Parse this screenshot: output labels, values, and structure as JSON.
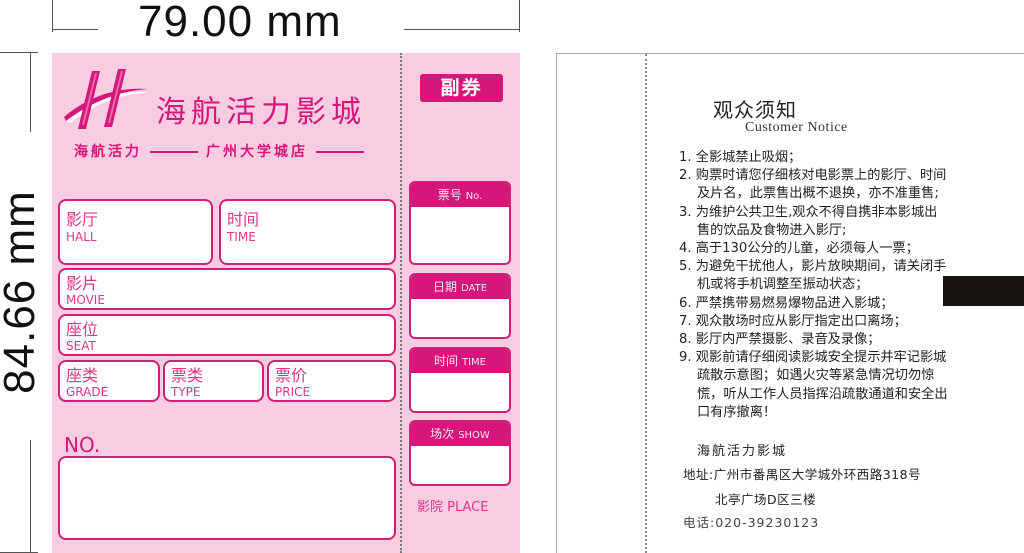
{
  "dimensions": {
    "width_label": "79.00 mm",
    "height_label": "84.66 mm"
  },
  "ticket_front": {
    "brand_name": "海航活力影城",
    "sub_brand_left": "海航活力",
    "sub_brand_right": "广州大学城店",
    "logo_icon": "hna-h-logo",
    "fields": {
      "hall": {
        "cn": "影厅",
        "en": "HALL"
      },
      "time": {
        "cn": "时间",
        "en": "TIME"
      },
      "movie": {
        "cn": "影片",
        "en": "MOVIE"
      },
      "seat": {
        "cn": "座位",
        "en": "SEAT"
      },
      "grade": {
        "cn": "座类",
        "en": "GRADE"
      },
      "type": {
        "cn": "票类",
        "en": "TYPE"
      },
      "price": {
        "cn": "票价",
        "en": "PRICE"
      }
    },
    "no_label": "NO.",
    "stub": {
      "title": "副券",
      "boxes": {
        "ticket_no": {
          "cn": "票号",
          "en": "No."
        },
        "date": {
          "cn": "日期",
          "en": "DATE"
        },
        "time": {
          "cn": "时间",
          "en": "TIME"
        },
        "show": {
          "cn": "场次",
          "en": "SHOW"
        }
      },
      "place_label": "影院 PLACE"
    },
    "colors": {
      "background": "#f8cde1",
      "accent": "#d6167a"
    }
  },
  "ticket_back": {
    "title": "观众须知",
    "subtitle": "Customer Notice",
    "rules": [
      "1. 全影城禁止吸烟；",
      "2. 购票时请您仔细核对电影票上的影厅、时间及片名，此票售出概不退换，亦不准重售;",
      "3. 为维护公共卫生,观众不得自携非本影城出售的饮品及食物进入影厅;",
      "4. 高于130公分的儿童，必须每人一票；",
      "5. 为避免干扰他人，影片放映期间，请关闭手机或将手机调整至振动状态；",
      "6. 严禁携带易燃易爆物品进入影城；",
      "7. 观众散场时应从影厅指定出口离场；",
      "8. 影厅内严禁摄影、录音及录像；",
      "9. 观影前请仔细阅读影城安全提示并牢记影城疏散示意图；如遇火灾等紧急情况切勿惊慌，听从工作人员指挥沿疏散通道和安全出口有序撤离！"
    ],
    "cinema_name": "海航活力影城",
    "address_line1": "地址:广州市番禺区大学城外环西路318号",
    "address_line2": "北亭广场D区三楼",
    "phone": "电话:020-39230123"
  }
}
